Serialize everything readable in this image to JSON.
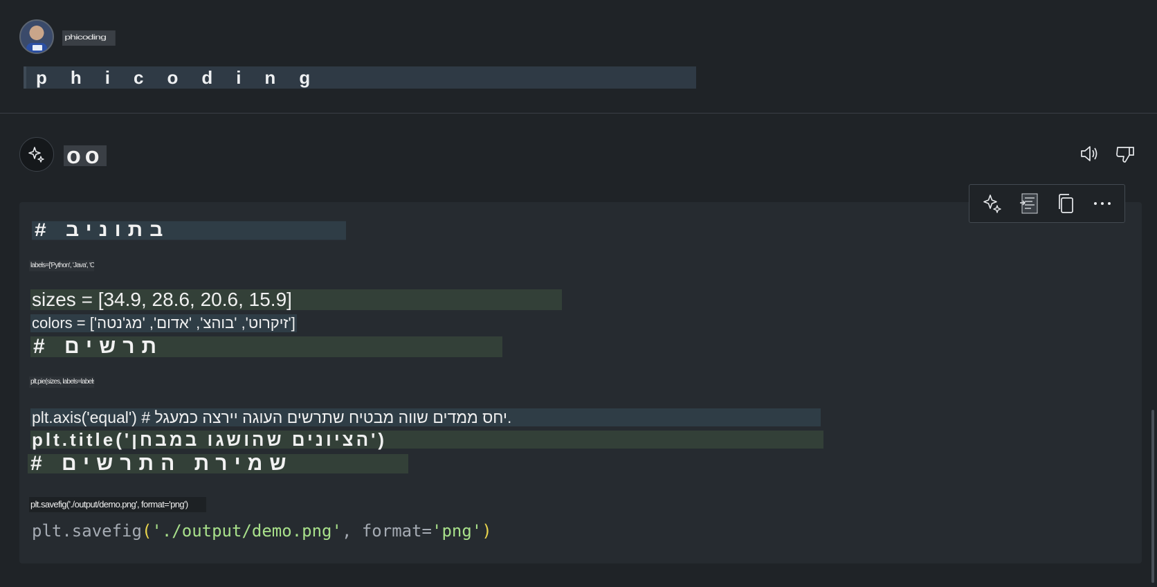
{
  "user": {
    "name": "phicoding",
    "prompt": "phicoding"
  },
  "assistant": {
    "name": "oo",
    "icons": {
      "assistant": "sparkle-icon",
      "read_aloud": "speaker-icon",
      "dislike": "thumbs-down-icon"
    }
  },
  "toolbar": {
    "icons": [
      "sparkle-icon",
      "insert-icon",
      "copy-icon",
      "more-icon"
    ]
  },
  "code": {
    "comment1": "# בתוניב",
    "tiny1": "labels=['Python', 'Java', 'C++', 'JS']",
    "sizes": "sizes = [34.9, 28.6, 20.6, 15.9]",
    "colors": "colors = ['זיקרוט', 'בוהצ', 'אדום', 'מג'נטה']",
    "comment2": "# תרשים",
    "tiny2": "plt.pie(sizes, labels=labels)",
    "axis": "plt.axis('equal') # יחס ממדים שווה מבטיח שתרשים העוגה יירצה כמעגל.",
    "title": "plt.title('הציונים שהושגו במבחן')",
    "comment3": "# שמירת התרשים",
    "tiny3": "plt.savefig('./output/demo.png', format='png')",
    "savefig": {
      "fn": "plt.savefig",
      "open": "(",
      "path": "'./output/demo.png'",
      "sep": ", format=",
      "fmt": "'png'",
      "close": ")"
    }
  },
  "colors": {
    "background": "#1f2327",
    "panel": "#262b30",
    "string": "#a8e08a",
    "paren": "#e8d44d"
  }
}
